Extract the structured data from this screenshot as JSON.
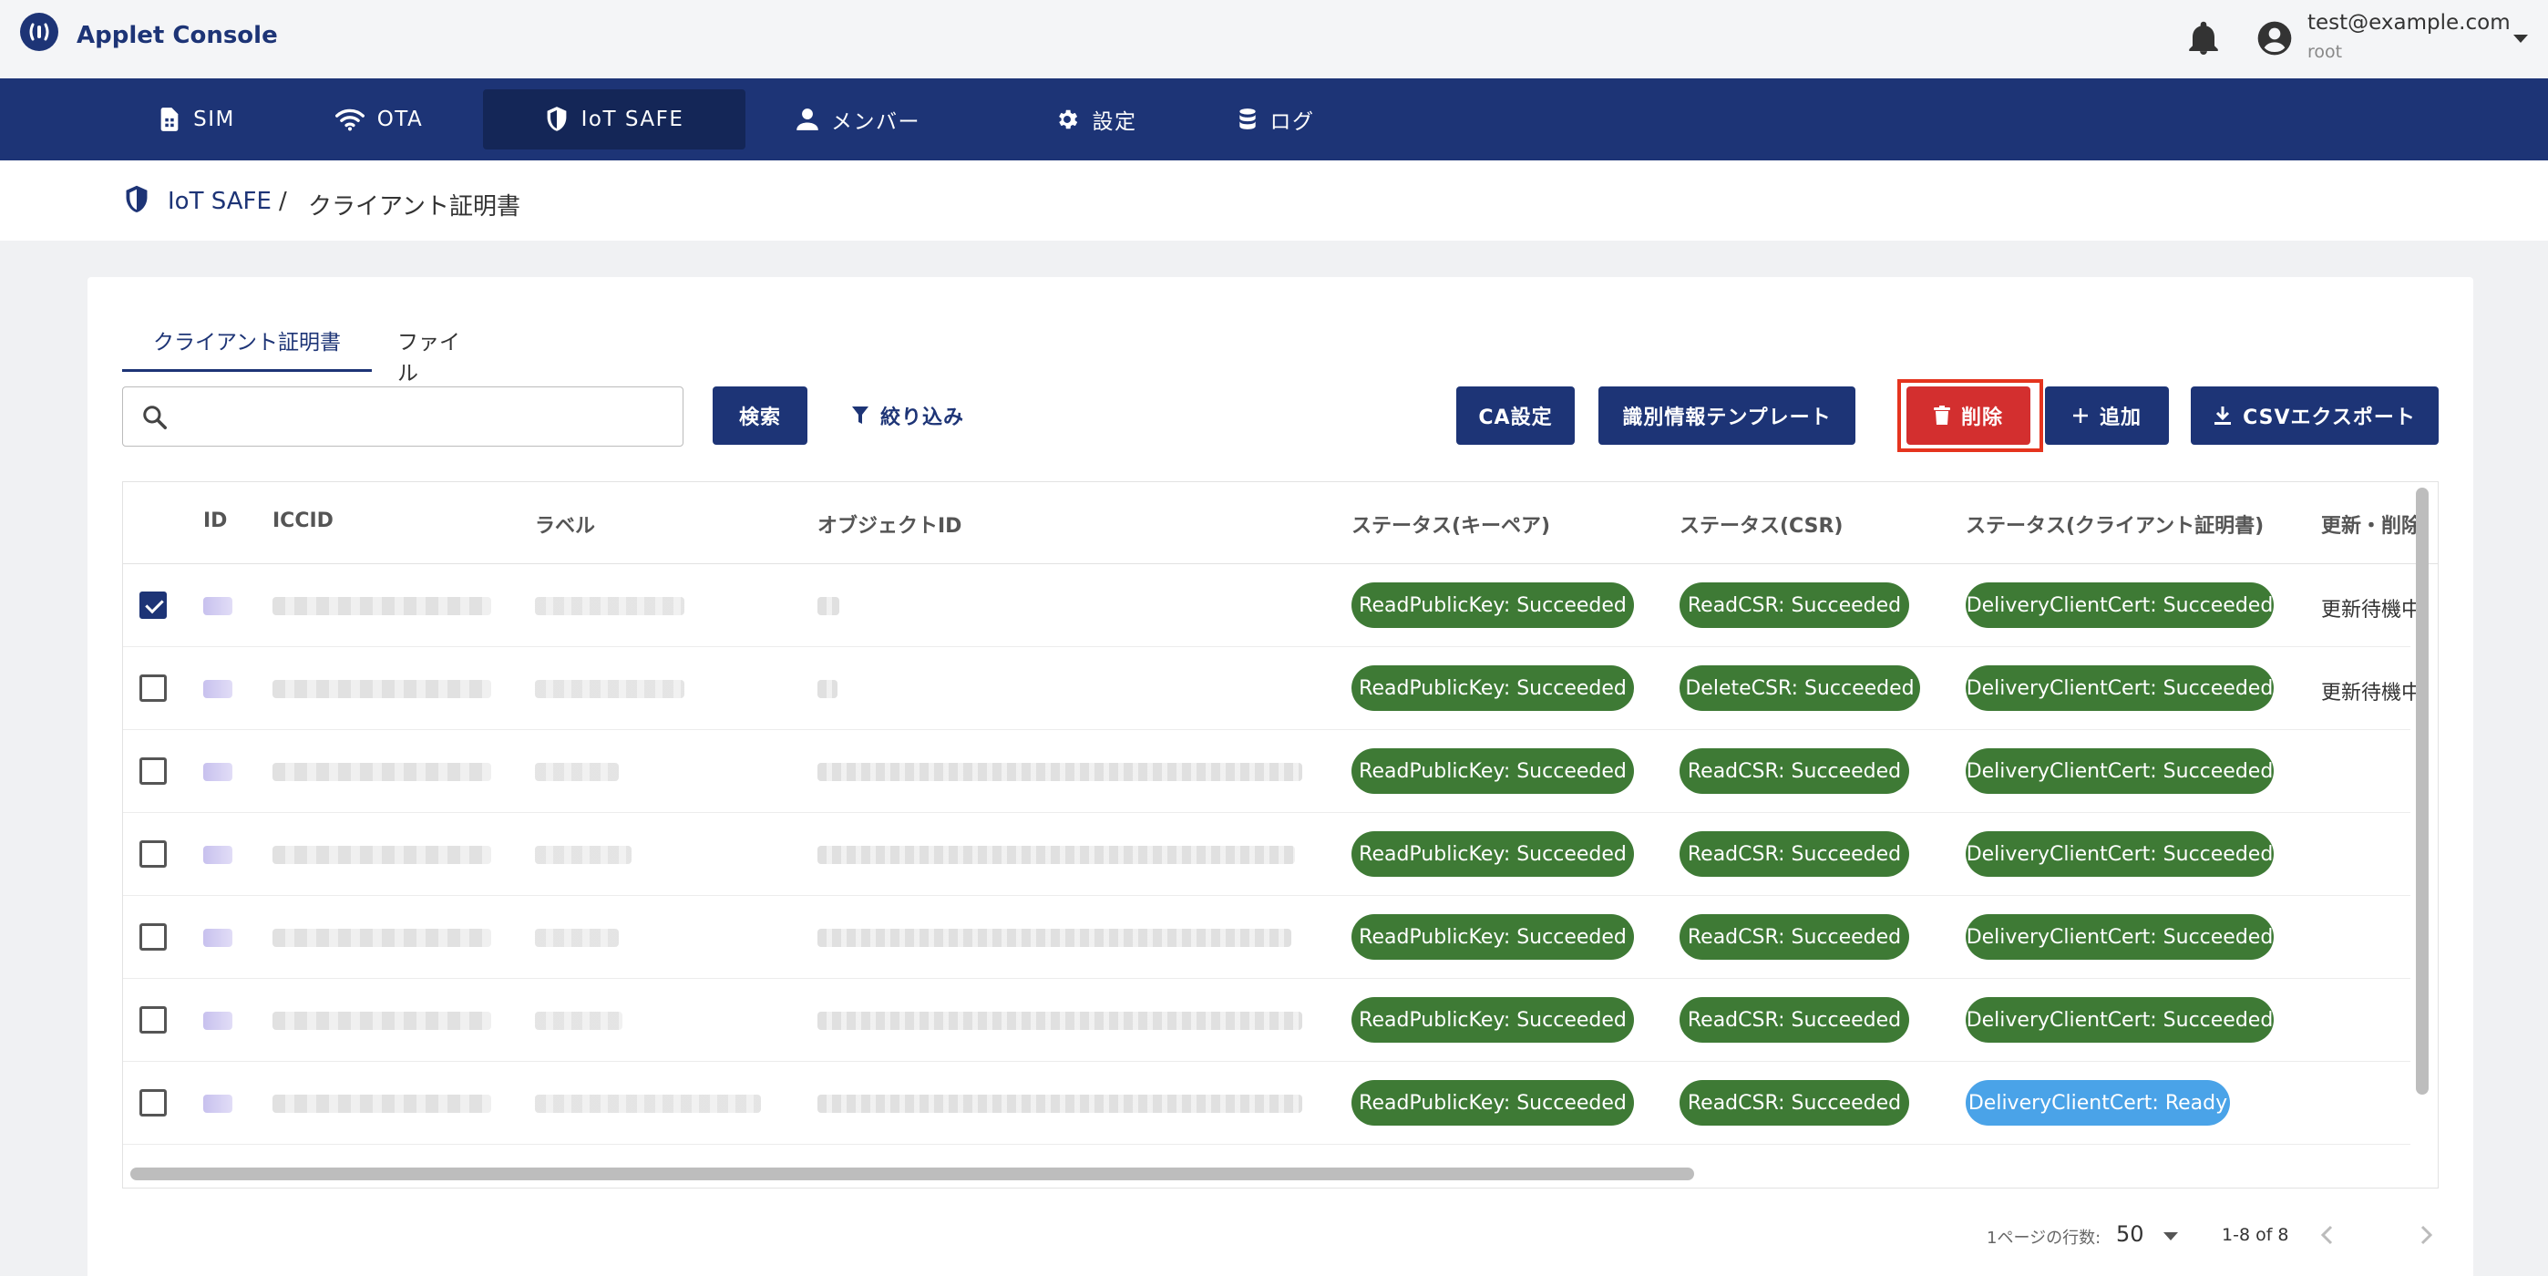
{
  "app": {
    "title": "Applet Console"
  },
  "user": {
    "email": "test@example.com",
    "role": "root"
  },
  "nav": {
    "items": [
      {
        "label": "SIM",
        "icon": "sim-card-icon"
      },
      {
        "label": "OTA",
        "icon": "wifi-icon"
      },
      {
        "label": "IoT SAFE",
        "icon": "shield-icon"
      },
      {
        "label": "メンバー",
        "icon": "person-icon"
      },
      {
        "label": "設定",
        "icon": "gear-icon"
      },
      {
        "label": "ログ",
        "icon": "database-icon"
      }
    ],
    "active": "IoT SAFE"
  },
  "breadcrumb": {
    "root": "IoT SAFE",
    "separator": "/",
    "current": "クライアント証明書"
  },
  "tabs": [
    {
      "label": "クライアント証明書",
      "active": true
    },
    {
      "label": "ファイル",
      "active": false
    }
  ],
  "search": {
    "value": "",
    "placeholder": ""
  },
  "toolbar": {
    "search_label": "検索",
    "filter_label": "絞り込み",
    "ca_label": "CA設定",
    "template_label": "識別情報テンプレート",
    "delete_label": "削除",
    "add_label": "追加",
    "csv_label": "CSVエクスポート"
  },
  "table": {
    "columns": {
      "id": "ID",
      "iccid": "ICCID",
      "label": "ラベル",
      "object_id": "オブジェクトID",
      "status_keypair": "ステータス(キーペア)",
      "status_csr": "ステータス(CSR)",
      "status_cert": "ステータス(クライアント証明書)",
      "renew": "更新・削除"
    },
    "rows": [
      {
        "checked": true,
        "keypair": "ReadPublicKey: Succeeded",
        "csr": "ReadCSR: Succeeded",
        "cert": "DeliveryClientCert: Succeeded",
        "cert_state": "success",
        "renew": "更新待機中"
      },
      {
        "checked": false,
        "keypair": "ReadPublicKey: Succeeded",
        "csr": "DeleteCSR: Succeeded",
        "cert": "DeliveryClientCert: Succeeded",
        "cert_state": "success",
        "renew": "更新待機中"
      },
      {
        "checked": false,
        "keypair": "ReadPublicKey: Succeeded",
        "csr": "ReadCSR: Succeeded",
        "cert": "DeliveryClientCert: Succeeded",
        "cert_state": "success",
        "renew": ""
      },
      {
        "checked": false,
        "keypair": "ReadPublicKey: Succeeded",
        "csr": "ReadCSR: Succeeded",
        "cert": "DeliveryClientCert: Succeeded",
        "cert_state": "success",
        "renew": ""
      },
      {
        "checked": false,
        "keypair": "ReadPublicKey: Succeeded",
        "csr": "ReadCSR: Succeeded",
        "cert": "DeliveryClientCert: Succeeded",
        "cert_state": "success",
        "renew": ""
      },
      {
        "checked": false,
        "keypair": "ReadPublicKey: Succeeded",
        "csr": "ReadCSR: Succeeded",
        "cert": "DeliveryClientCert: Succeeded",
        "cert_state": "success",
        "renew": ""
      },
      {
        "checked": false,
        "keypair": "ReadPublicKey: Succeeded",
        "csr": "ReadCSR: Succeeded",
        "cert": "DeliveryClientCert: Ready",
        "cert_state": "ready",
        "renew": ""
      }
    ]
  },
  "pagination": {
    "rows_per_page_label": "1ページの行数:",
    "rows_per_page": "50",
    "range": "1-8 of 8"
  },
  "colors": {
    "primary": "#1d3476",
    "danger": "#d32f2f",
    "success_chip": "#3e7a35",
    "ready_chip": "#4aa3e8",
    "highlight": "#e5341e"
  }
}
